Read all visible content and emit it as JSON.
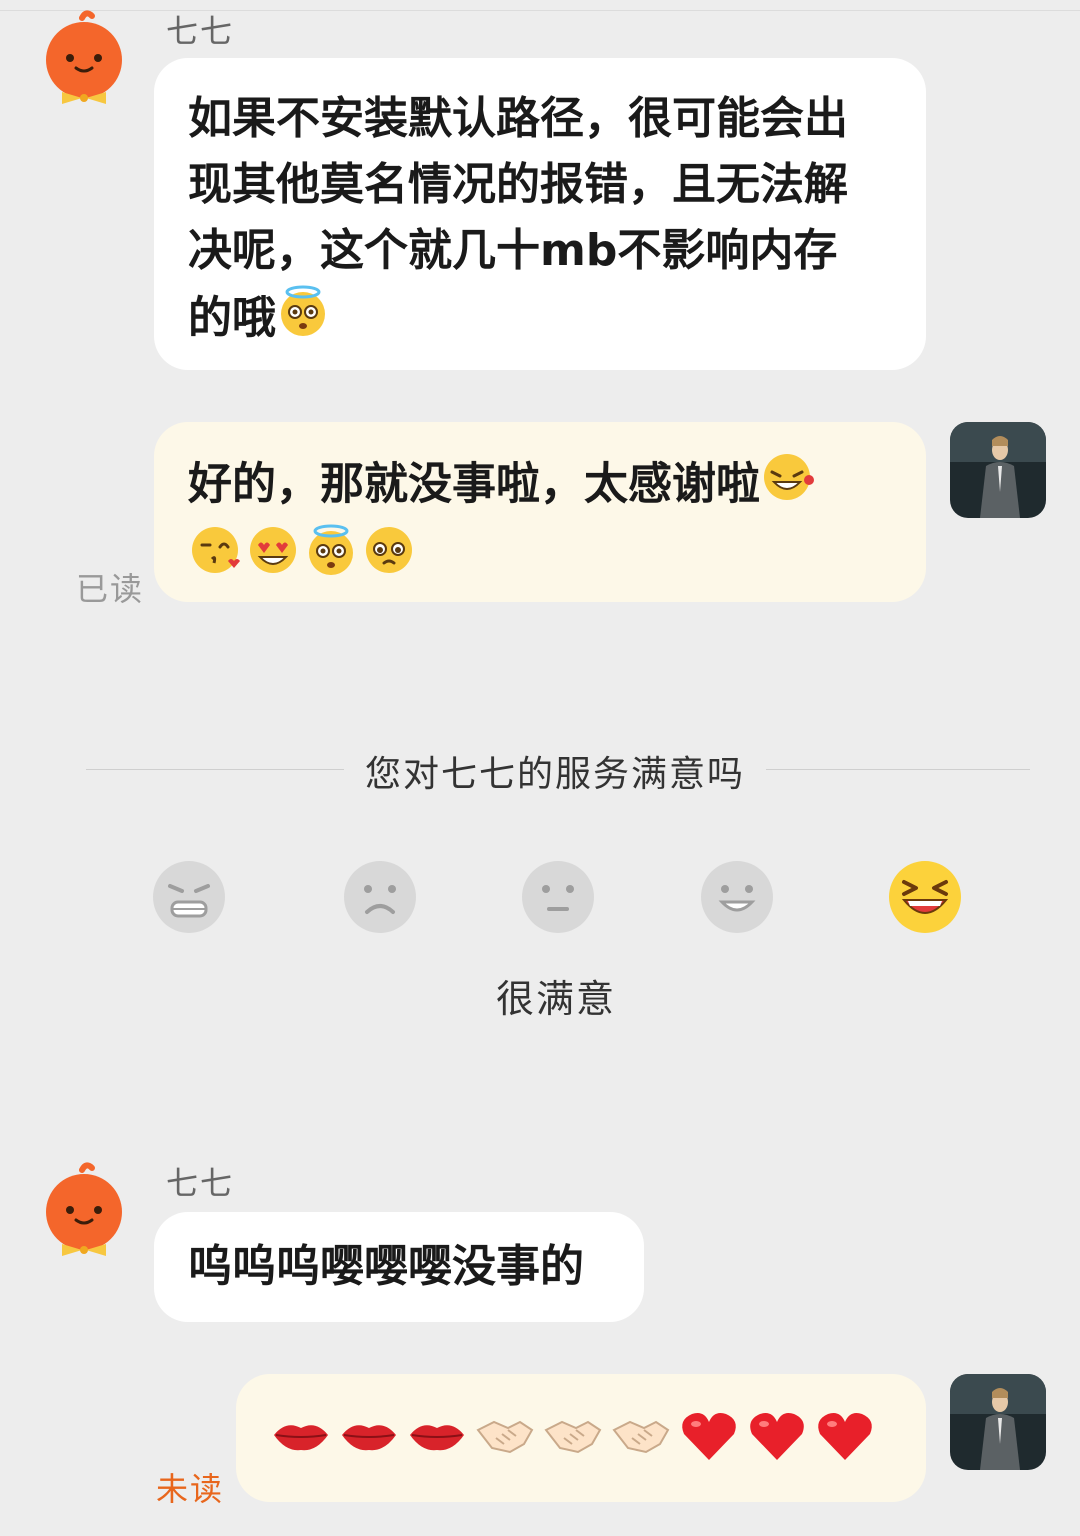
{
  "messages": [
    {
      "sender": "七七",
      "side": "left",
      "text": "如果不安装默认路径，很可能会出现其他莫名情况的报错，且无法解决呢，这个就几十mb不影响内存的哦",
      "lines": [
        "如果不安装默认路径，很可能会出",
        "现其他莫名情况的报错，且无法解",
        "决呢，这个就几十mb不影响内存",
        "的哦"
      ],
      "trailing_emoji": "starstruck-halo-face-emoji"
    },
    {
      "sender": "",
      "side": "right",
      "text": "好的，那就没事啦，太感谢啦",
      "trailing_emoji": "laughing-tear-face-emoji",
      "emojis": [
        "kissing-heart-face-emoji",
        "heart-eyes-face-emoji",
        "starstruck-halo-face-emoji",
        "pleading-face-emoji"
      ],
      "status": "已读"
    },
    {
      "sender": "七七",
      "side": "left",
      "text": "呜呜呜嘤嘤嘤没事的"
    },
    {
      "sender": "",
      "side": "right",
      "emojis": [
        "lips-emoji",
        "lips-emoji",
        "lips-emoji",
        "handshake-emoji",
        "handshake-emoji",
        "handshake-emoji",
        "red-heart-emoji",
        "red-heart-emoji",
        "red-heart-emoji"
      ],
      "status": "未读"
    }
  ],
  "survey": {
    "title": "您对七七的服务满意吗",
    "selected_label": "很满意",
    "options": [
      "angry-face-icon",
      "frown-face-icon",
      "neutral-face-icon",
      "smile-face-icon",
      "laughing-face-icon"
    ],
    "selected_index": 4
  },
  "colors": {
    "background": "#ededed",
    "bubble_left": "#ffffff",
    "bubble_right": "#fdf8e8",
    "unread": "#e8661c",
    "read": "#999999",
    "mascot": "#f4662b"
  }
}
